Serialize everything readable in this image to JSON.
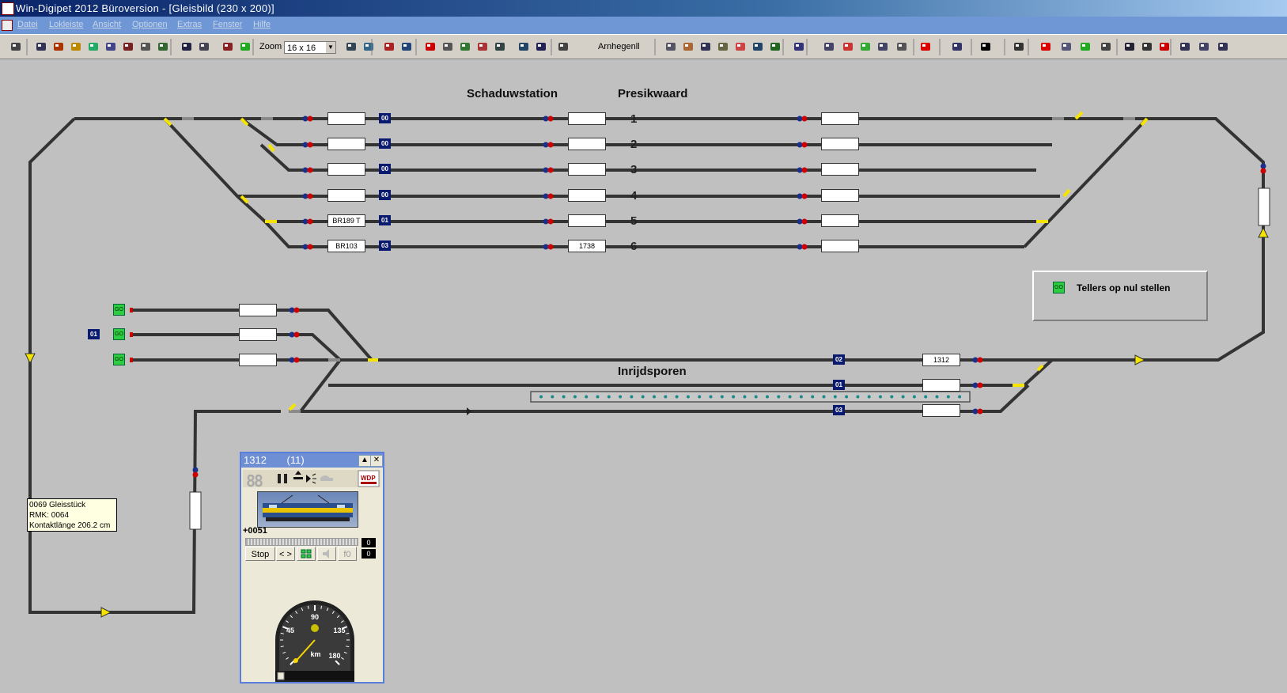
{
  "titlebar": {
    "title": "Win-Digipet 2012 Büroversion  - [Gleisbild (230 x 200)]"
  },
  "menu": {
    "items": [
      "Datei",
      "Lokleiste",
      "Ansicht",
      "Optionen",
      "Extras",
      "Fenster",
      "Hilfe"
    ]
  },
  "toolbar": {
    "zoom_label": "Zoom",
    "zoom_value": "16 x 16",
    "profile_label": "Arnhegenll"
  },
  "layout": {
    "title_left": "Schaduwstation",
    "title_right": "Presikwaard",
    "title_entry": "Inrijdsporen",
    "track_numbers": [
      "1",
      "2",
      "3",
      "4",
      "5",
      "6"
    ],
    "shadow_left_boxes": [
      "",
      "",
      "",
      "",
      "BR189 T",
      "BR103"
    ],
    "shadow_badges": [
      "00",
      "00",
      "00",
      "00",
      "01",
      "03"
    ],
    "shadow_mid_boxes": [
      "",
      "",
      "",
      "",
      "",
      "1738"
    ],
    "shadow_right_boxes": [
      "",
      "",
      "",
      "",
      "",
      ""
    ],
    "entry_badges": [
      "02",
      "01",
      "03"
    ],
    "entry_boxes": [
      "1312",
      "",
      ""
    ],
    "left_badge": "01",
    "reset_label": "Tellers op nul stellen",
    "go_label": "GO"
  },
  "tooltip": {
    "line1": "0069 Gleisstück",
    "line2": "RMK: 0064",
    "line3": "Kontaktlänge 206.2 cm"
  },
  "loco_window": {
    "title": "1312",
    "address": "(11)",
    "display": "88",
    "counter": "+0051",
    "bar_value": "0",
    "stop_label": "Stop",
    "dir_label": "< >",
    "f0_label": "f0",
    "f_value": "0",
    "speed_ticks": [
      "45",
      "90",
      "135",
      "180"
    ],
    "speed_unit": "km"
  }
}
